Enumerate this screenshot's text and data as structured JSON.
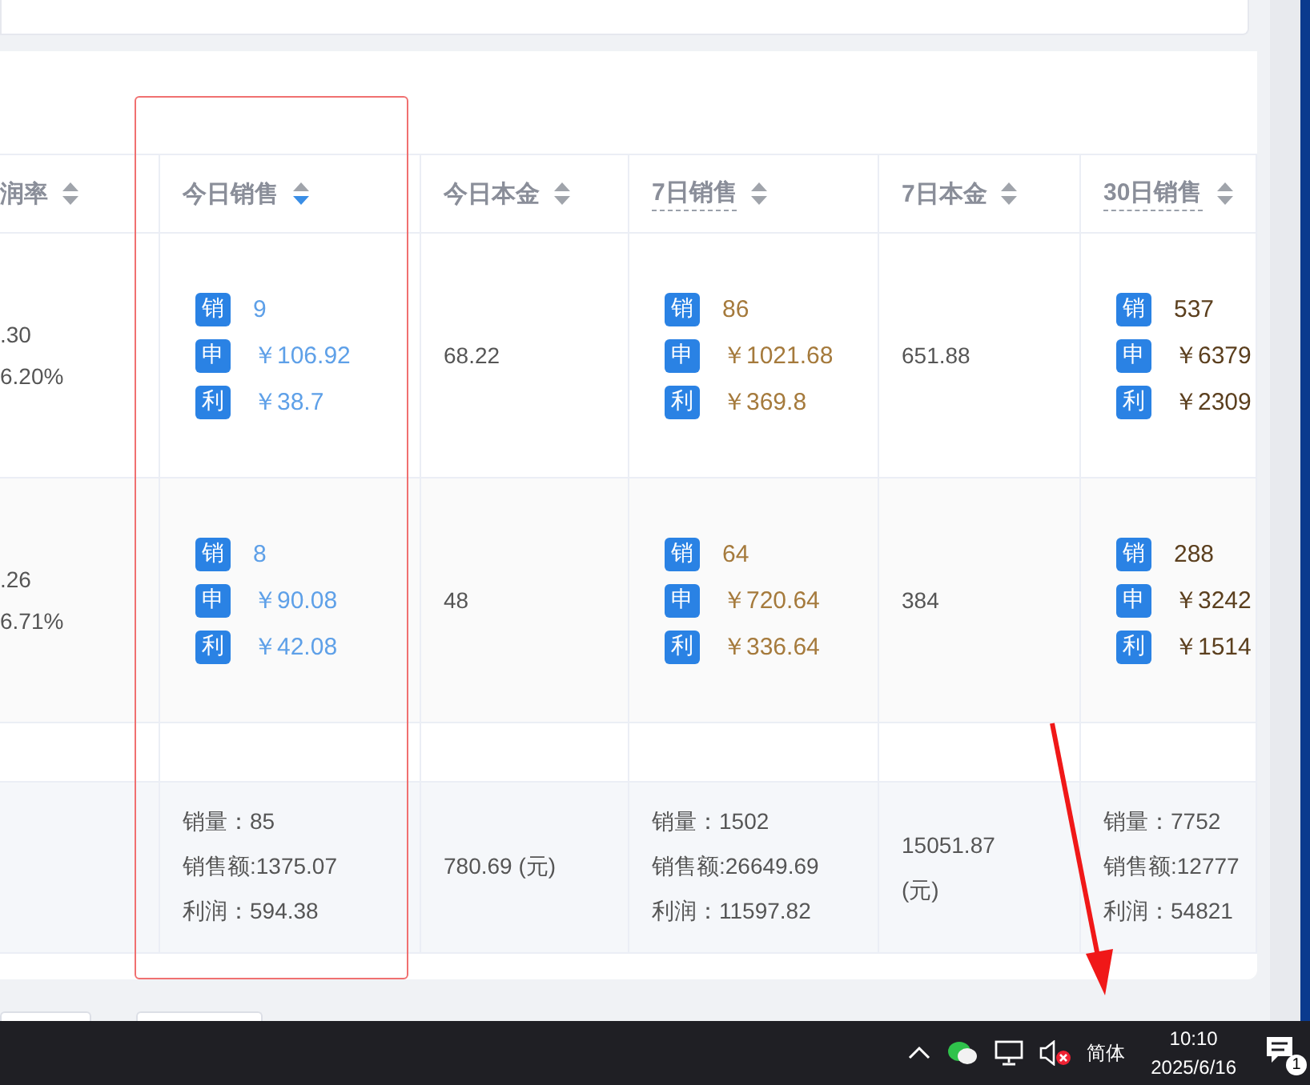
{
  "table": {
    "columns": [
      {
        "label": "润率",
        "sorted": false,
        "hint": false
      },
      {
        "label": "今日销售",
        "sorted": true,
        "hint": false
      },
      {
        "label": "今日本金",
        "sorted": false,
        "hint": false
      },
      {
        "label": "7日销售",
        "sorted": false,
        "hint": true
      },
      {
        "label": "7日本金",
        "sorted": false,
        "hint": false
      },
      {
        "label": "30日销售",
        "sorted": false,
        "hint": true
      }
    ],
    "rows": [
      {
        "cells": [
          {
            "kind": "lines",
            "lines": [
              ".30",
              "6.20%"
            ]
          },
          {
            "kind": "tags",
            "color": "#5ea0e8",
            "items": [
              {
                "tag": "销",
                "value": "9"
              },
              {
                "tag": "申",
                "value": "￥106.92"
              },
              {
                "tag": "利",
                "value": "￥38.7"
              }
            ]
          },
          {
            "kind": "lines",
            "lines": [
              "68.22"
            ]
          },
          {
            "kind": "tags",
            "color": "#a57a3c",
            "items": [
              {
                "tag": "销",
                "value": "86"
              },
              {
                "tag": "申",
                "value": "￥1021.68"
              },
              {
                "tag": "利",
                "value": "￥369.8"
              }
            ]
          },
          {
            "kind": "lines",
            "lines": [
              "651.88"
            ]
          },
          {
            "kind": "tags",
            "color": "#5b3f1e",
            "items": [
              {
                "tag": "销",
                "value": "537"
              },
              {
                "tag": "申",
                "value": "￥6379"
              },
              {
                "tag": "利",
                "value": "￥2309"
              }
            ]
          }
        ]
      },
      {
        "cells": [
          {
            "kind": "lines",
            "lines": [
              ".26",
              "6.71%"
            ]
          },
          {
            "kind": "tags",
            "color": "#5ea0e8",
            "items": [
              {
                "tag": "销",
                "value": "8"
              },
              {
                "tag": "申",
                "value": "￥90.08"
              },
              {
                "tag": "利",
                "value": "￥42.08"
              }
            ]
          },
          {
            "kind": "lines",
            "lines": [
              "48"
            ]
          },
          {
            "kind": "tags",
            "color": "#a57a3c",
            "items": [
              {
                "tag": "销",
                "value": "64"
              },
              {
                "tag": "申",
                "value": "￥720.64"
              },
              {
                "tag": "利",
                "value": "￥336.64"
              }
            ]
          },
          {
            "kind": "lines",
            "lines": [
              "384"
            ]
          },
          {
            "kind": "tags",
            "color": "#5b3f1e",
            "items": [
              {
                "tag": "销",
                "value": "288"
              },
              {
                "tag": "申",
                "value": "￥3242"
              },
              {
                "tag": "利",
                "value": "￥1514"
              }
            ]
          }
        ]
      }
    ],
    "summary": [
      {
        "lines": [
          "销量：85",
          "销售额:1375.07",
          "利润：594.38"
        ]
      },
      {
        "lines": [
          "780.69 (元)"
        ]
      },
      {
        "lines": [
          "销量：1502",
          "销售额:26649.69",
          "利润：11597.82"
        ]
      },
      {
        "lines": [
          "15051.87 (元)"
        ]
      },
      {
        "lines": [
          "销量：7752",
          "销售额:12777",
          "利润：54821"
        ]
      }
    ]
  },
  "taskbar": {
    "ime": "简体",
    "time": "10:10",
    "date": "2025/6/16",
    "notifications": "1"
  }
}
